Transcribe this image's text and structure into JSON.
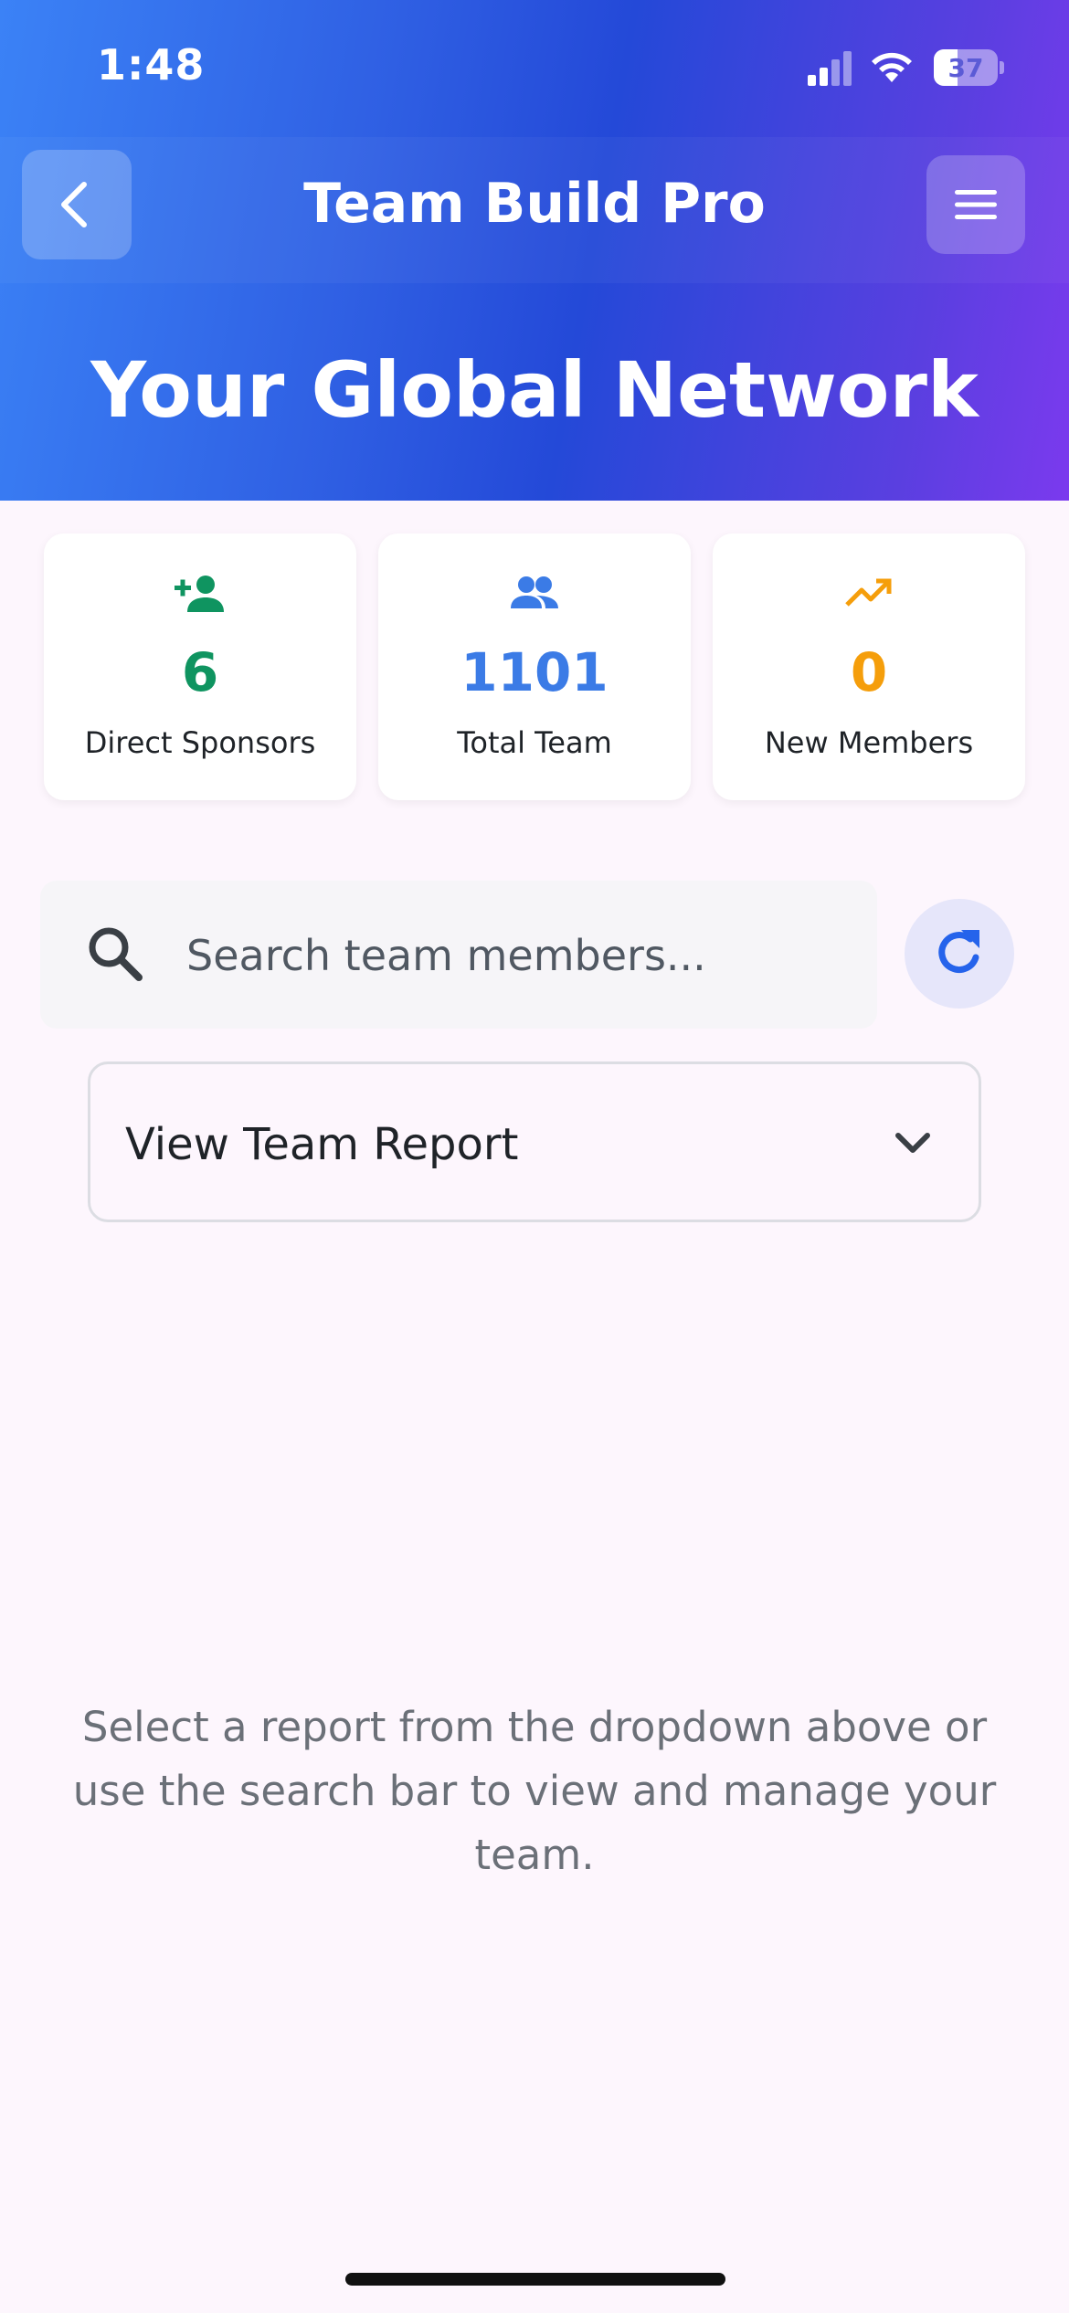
{
  "status_bar": {
    "time": "1:48",
    "battery": "37"
  },
  "appbar": {
    "title": "Team Build Pro",
    "back_icon": "chevron-left-icon",
    "menu_icon": "hamburger-menu-icon"
  },
  "hero": {
    "title": "Your Global Network"
  },
  "stats": [
    {
      "icon": "person-add-icon",
      "value": "6",
      "label": "Direct Sponsors",
      "color": "#0f9460"
    },
    {
      "icon": "group-icon",
      "value": "1101",
      "label": "Total Team",
      "color": "#3b7be6"
    },
    {
      "icon": "trending-up-icon",
      "value": "0",
      "label": "New Members",
      "color": "#f59e0b"
    }
  ],
  "search": {
    "placeholder": "Search team members...",
    "value": ""
  },
  "report": {
    "selected": "View Team Report"
  },
  "empty_message": "Select a report from the dropdown above or use the search bar to view and manage your team.",
  "colors": {
    "header_start": "#3b82f6",
    "header_mid": "#2449d8",
    "header_end": "#7b3aee",
    "background": "#fdf6fd",
    "accent": "#2563eb"
  }
}
